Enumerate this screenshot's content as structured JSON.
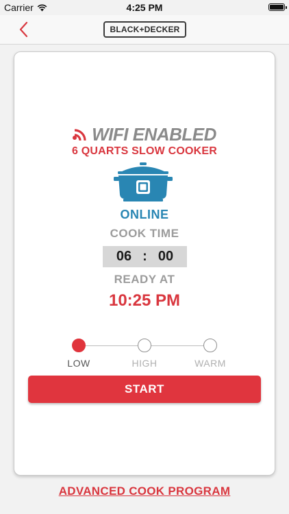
{
  "status_bar": {
    "carrier": "Carrier",
    "time": "4:25 PM"
  },
  "nav": {
    "brand": "BLACK+DECKER"
  },
  "device": {
    "wifi_title": "WIFI ENABLED",
    "product_name": "6 QUARTS SLOW COOKER",
    "status": "ONLINE"
  },
  "cook_time": {
    "label": "COOK TIME",
    "hours": "06",
    "separator": ":",
    "minutes": "00"
  },
  "ready": {
    "label": "READY AT",
    "time": "10:25 PM"
  },
  "modes": {
    "selected": "LOW",
    "items": [
      "LOW",
      "HIGH",
      "WARM"
    ]
  },
  "actions": {
    "start": "START",
    "advanced": "ADVANCED COOK PROGRAM"
  },
  "colors": {
    "accent_red": "#d9363e",
    "online_blue": "#2986b3",
    "label_gray": "#9b9b9b"
  }
}
